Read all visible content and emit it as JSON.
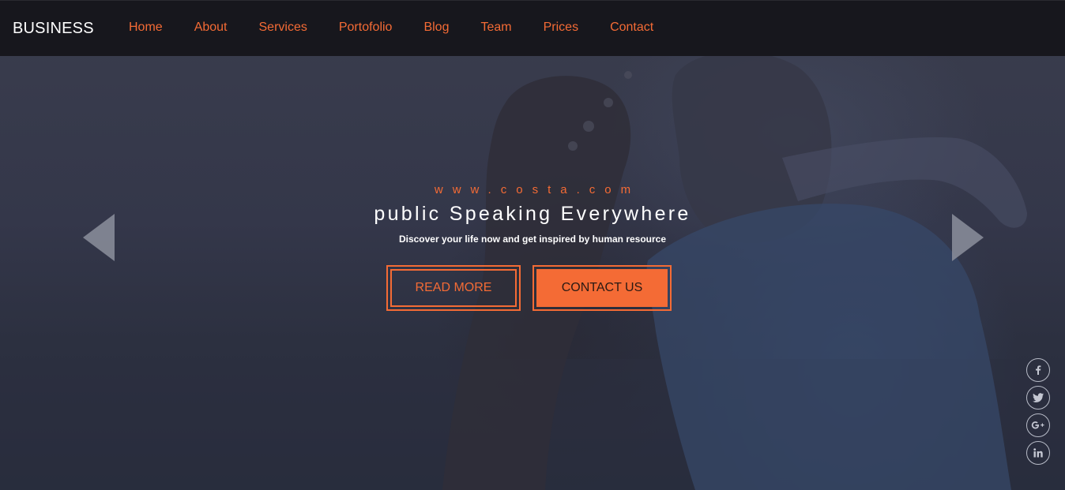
{
  "brand": "BUSINESS",
  "nav": [
    "Home",
    "About",
    "Services",
    "Portofolio",
    "Blog",
    "Team",
    "Prices",
    "Contact"
  ],
  "hero": {
    "site_url": "www.costa.com",
    "headline": "public Speaking Everywhere",
    "tagline": "Discover your life now and get inspired by human resource",
    "read_more_label": "READ MORE",
    "contact_label": "CONTACT US"
  },
  "social_icons": [
    "facebook-icon",
    "twitter-icon",
    "google-plus-icon",
    "linkedin-icon"
  ],
  "colors": {
    "accent": "#f46b35",
    "navbar": "#17171d",
    "overlay": "#34374a"
  }
}
